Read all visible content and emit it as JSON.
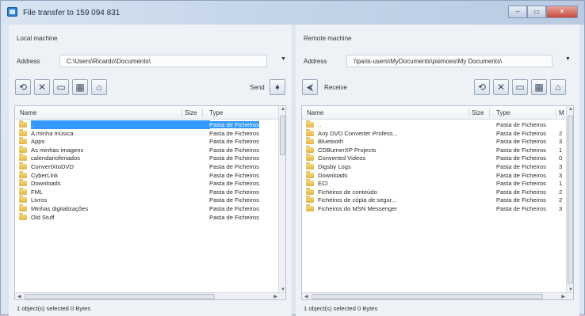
{
  "window": {
    "title": "File transfer to 159 094 831",
    "min": "–",
    "max": "▭",
    "close": "✕"
  },
  "local": {
    "section": "Local machine",
    "address_label": "Address",
    "address": "C:\\Users\\Ricardo\\Documents\\",
    "send_label": "Send",
    "columns": {
      "name": "Name",
      "size": "Size",
      "type": "Type"
    },
    "rows": [
      {
        "name": "..",
        "type": "Pasta de Ficheiros",
        "selected": true
      },
      {
        "name": "A minha música",
        "type": "Pasta de Ficheiros"
      },
      {
        "name": "Apps",
        "type": "Pasta de Ficheiros"
      },
      {
        "name": "As minhas imagens",
        "type": "Pasta de Ficheiros"
      },
      {
        "name": "calendarioferiados",
        "type": "Pasta de Ficheiros"
      },
      {
        "name": "ConvertXtoDVD",
        "type": "Pasta de Ficheiros"
      },
      {
        "name": "CyberLink",
        "type": "Pasta de Ficheiros"
      },
      {
        "name": "Downloads",
        "type": "Pasta de Ficheiros"
      },
      {
        "name": "FML",
        "type": "Pasta de Ficheiros"
      },
      {
        "name": "Livros",
        "type": "Pasta de Ficheiros"
      },
      {
        "name": "Minhas digitalizações",
        "type": "Pasta de Ficheiros"
      },
      {
        "name": "Old Stuff",
        "type": "Pasta de Ficheiros"
      }
    ],
    "status": "1 object(s) selected   0 Bytes"
  },
  "remote": {
    "section": "Remote machine",
    "address_label": "Address",
    "address": "\\\\paris-users\\MyDocuments\\psimoes\\My Documents\\",
    "receive_label": "Receive",
    "columns": {
      "name": "Name",
      "size": "Size",
      "type": "Type",
      "extra": "M"
    },
    "rows": [
      {
        "name": "..",
        "type": "Pasta de Ficheiros",
        "extra": ""
      },
      {
        "name": "Any DVD Converter Profess...",
        "type": "Pasta de Ficheiros",
        "extra": "2"
      },
      {
        "name": "Bluetooth",
        "type": "Pasta de Ficheiros",
        "extra": "3"
      },
      {
        "name": "CDBurnerXP Projects",
        "type": "Pasta de Ficheiros",
        "extra": "1"
      },
      {
        "name": "Converted Videos",
        "type": "Pasta de Ficheiros",
        "extra": "0"
      },
      {
        "name": "Digsby Logs",
        "type": "Pasta de Ficheiros",
        "extra": "3"
      },
      {
        "name": "Downloads",
        "type": "Pasta de Ficheiros",
        "extra": "3"
      },
      {
        "name": "ECI",
        "type": "Pasta de Ficheiros",
        "extra": "1"
      },
      {
        "name": "Ficheiros de conteúdo",
        "type": "Pasta de Ficheiros",
        "extra": "2"
      },
      {
        "name": "Ficheiros de cópia de segur...",
        "type": "Pasta de Ficheiros",
        "extra": "2"
      },
      {
        "name": "Ficheiros do MSN Messenger",
        "type": "Pasta de Ficheiros",
        "extra": "3"
      }
    ],
    "status": "1 object(s) selected   0 Bytes"
  },
  "icons": {
    "refresh": "refresh-icon",
    "delete": "delete-icon",
    "new_folder": "new-folder-icon",
    "rename": "rename-icon",
    "home": "home-icon",
    "send": "send-arrow-icon",
    "receive": "receive-arrow-icon"
  }
}
